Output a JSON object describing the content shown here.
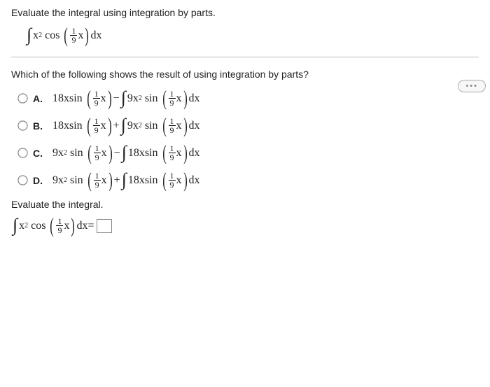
{
  "question": {
    "prompt": "Evaluate the integral using integration by parts.",
    "subprompt": "Which of the following shows the result of using integration by parts?",
    "eval_label": "Evaluate the integral."
  },
  "options": {
    "a_label": "A.",
    "b_label": "B.",
    "c_label": "C.",
    "d_label": "D."
  },
  "sym": {
    "integral": "∫",
    "cos": "cos",
    "sin": "sin",
    "dx": "dx",
    "x": "x",
    "one": "1",
    "nine": "9",
    "minus": " − ",
    "plus": " + ",
    "equals": " = ",
    "lparen": "(",
    "rparen": ")",
    "x2": "x",
    "squared": "2",
    "coef18x": "18x ",
    "coef9x2": "9x"
  },
  "dots": "•••"
}
